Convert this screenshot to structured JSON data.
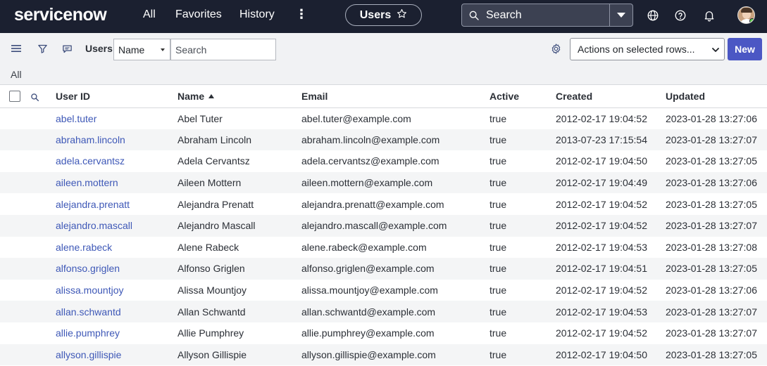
{
  "app": {
    "logo_text": "servicenow"
  },
  "topnav": {
    "all": "All",
    "favorites": "Favorites",
    "history": "History",
    "more": "⋮",
    "context_title": "Users",
    "search_label": "Search"
  },
  "toolbar": {
    "list_title": "Users",
    "field_selected": "Name",
    "search_placeholder": "Search",
    "actions_selected": "Actions on selected rows...",
    "new_label": "New"
  },
  "breadcrumb": {
    "label": "All"
  },
  "table": {
    "columns": {
      "user_id": "User ID",
      "name": "Name",
      "email": "Email",
      "active": "Active",
      "created": "Created",
      "updated": "Updated"
    },
    "sort": {
      "column": "Name",
      "direction": "ascending"
    },
    "rows": [
      {
        "user_id": "abel.tuter",
        "name": "Abel Tuter",
        "email": "abel.tuter@example.com",
        "active": "true",
        "created": "2012-02-17 19:04:52",
        "updated": "2023-01-28 13:27:06"
      },
      {
        "user_id": "abraham.lincoln",
        "name": "Abraham Lincoln",
        "email": "abraham.lincoln@example.com",
        "active": "true",
        "created": "2013-07-23 17:15:54",
        "updated": "2023-01-28 13:27:07"
      },
      {
        "user_id": "adela.cervantsz",
        "name": "Adela Cervantsz",
        "email": "adela.cervantsz@example.com",
        "active": "true",
        "created": "2012-02-17 19:04:50",
        "updated": "2023-01-28 13:27:05"
      },
      {
        "user_id": "aileen.mottern",
        "name": "Aileen Mottern",
        "email": "aileen.mottern@example.com",
        "active": "true",
        "created": "2012-02-17 19:04:49",
        "updated": "2023-01-28 13:27:06"
      },
      {
        "user_id": "alejandra.prenatt",
        "name": "Alejandra Prenatt",
        "email": "alejandra.prenatt@example.com",
        "active": "true",
        "created": "2012-02-17 19:04:52",
        "updated": "2023-01-28 13:27:05"
      },
      {
        "user_id": "alejandro.mascall",
        "name": "Alejandro Mascall",
        "email": "alejandro.mascall@example.com",
        "active": "true",
        "created": "2012-02-17 19:04:52",
        "updated": "2023-01-28 13:27:07"
      },
      {
        "user_id": "alene.rabeck",
        "name": "Alene Rabeck",
        "email": "alene.rabeck@example.com",
        "active": "true",
        "created": "2012-02-17 19:04:53",
        "updated": "2023-01-28 13:27:08"
      },
      {
        "user_id": "alfonso.griglen",
        "name": "Alfonso Griglen",
        "email": "alfonso.griglen@example.com",
        "active": "true",
        "created": "2012-02-17 19:04:51",
        "updated": "2023-01-28 13:27:05"
      },
      {
        "user_id": "alissa.mountjoy",
        "name": "Alissa Mountjoy",
        "email": "alissa.mountjoy@example.com",
        "active": "true",
        "created": "2012-02-17 19:04:52",
        "updated": "2023-01-28 13:27:06"
      },
      {
        "user_id": "allan.schwantd",
        "name": "Allan Schwantd",
        "email": "allan.schwantd@example.com",
        "active": "true",
        "created": "2012-02-17 19:04:53",
        "updated": "2023-01-28 13:27:07"
      },
      {
        "user_id": "allie.pumphrey",
        "name": "Allie Pumphrey",
        "email": "allie.pumphrey@example.com",
        "active": "true",
        "created": "2012-02-17 19:04:52",
        "updated": "2023-01-28 13:27:07"
      },
      {
        "user_id": "allyson.gillispie",
        "name": "Allyson Gillispie",
        "email": "allyson.gillispie@example.com",
        "active": "true",
        "created": "2012-02-17 19:04:50",
        "updated": "2023-01-28 13:27:05"
      }
    ]
  },
  "icons": {
    "nav_more": "more-vertical-icon",
    "favorite": "star-icon",
    "search": "search-icon",
    "globe": "globe-icon",
    "help": "help-icon",
    "notifications": "bell-icon",
    "list_menu": "hamburger-icon",
    "filter": "filter-icon",
    "conversation": "chat-icon",
    "settings": "gear-icon"
  },
  "colors": {
    "nav_background": "#1b2030",
    "link": "#3e58b7",
    "primary_button": "#4b57c4",
    "status_green": "#62d84e"
  }
}
